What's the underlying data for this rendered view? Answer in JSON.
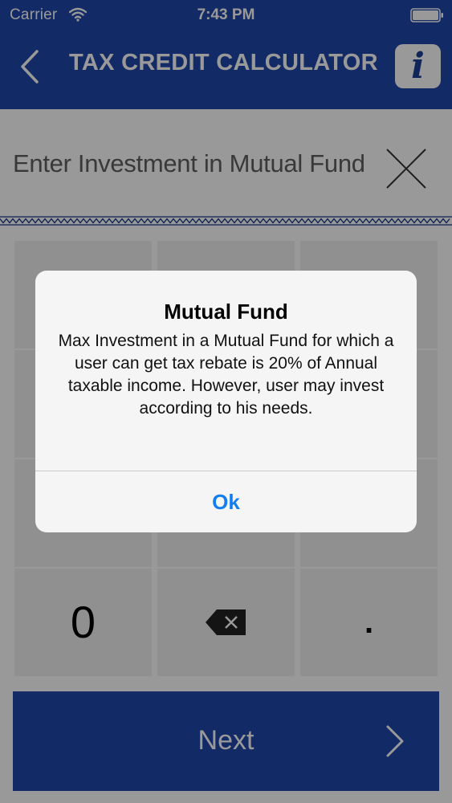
{
  "status_bar": {
    "carrier": "Carrier",
    "time": "7:43 PM",
    "wifi_icon": "wifi-icon",
    "battery_icon": "battery-icon"
  },
  "nav": {
    "back_icon": "chevron-left-icon",
    "title": "TAX CREDIT CALCULATOR",
    "info_label": "i",
    "bar_color": "#1f46a8"
  },
  "input": {
    "placeholder": "Enter Investment in Mutual Fund",
    "value": "",
    "clear_icon": "close-icon"
  },
  "keypad": {
    "bottom_row": {
      "zero": "0",
      "backspace_icon": "backspace-icon",
      "decimal": "."
    }
  },
  "next_button": {
    "label": "Next",
    "chevron_icon": "chevron-right-icon",
    "color": "#1f46a8"
  },
  "alert": {
    "title": "Mutual Fund",
    "message": "Max Investment in a Mutual Fund for which a user can get tax rebate is 20% of Annual taxable income. However, user may invest according to his needs.",
    "ok_label": "Ok",
    "ok_color": "#127ef0"
  }
}
